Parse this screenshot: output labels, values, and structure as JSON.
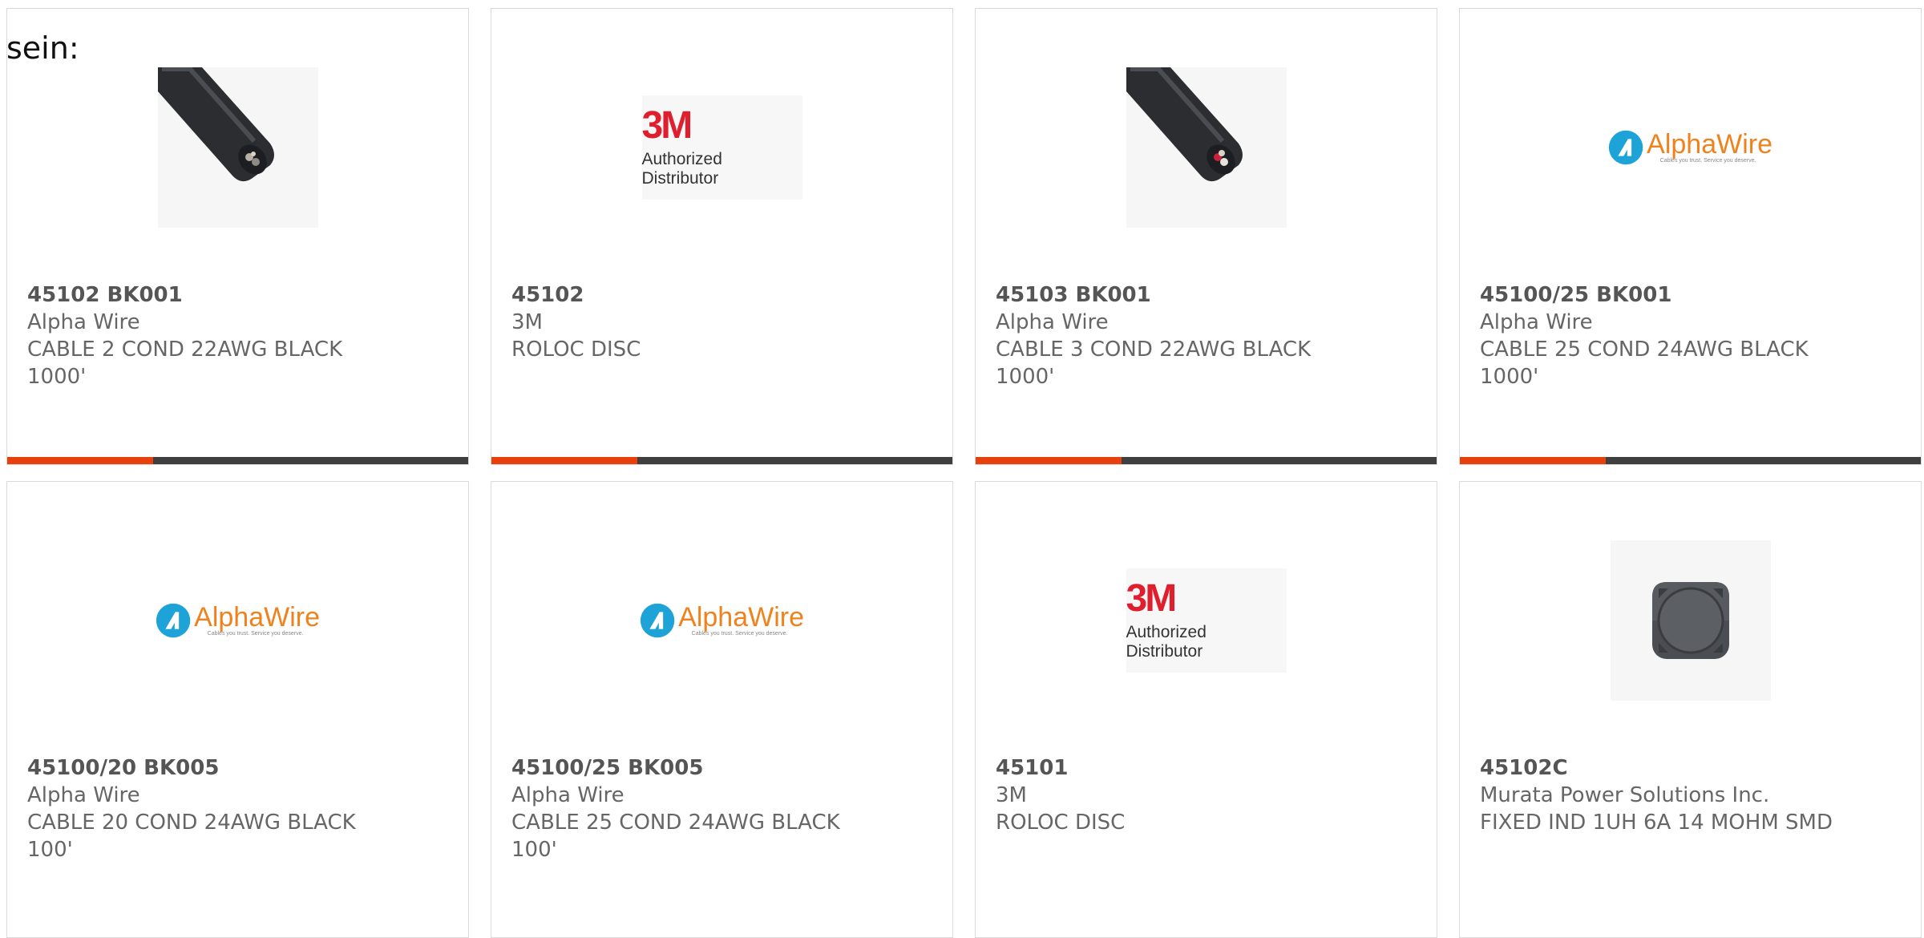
{
  "intro_text": "sein:",
  "colors": {
    "accent": "#e8400c",
    "bar": "#3f3f3f",
    "card_border": "#d9d9d9",
    "text": "#666666",
    "logo_3m_red": "#e01f2e",
    "alphawire_orange": "#f0821e",
    "alphawire_blue": "#1ea3d8"
  },
  "products": [
    {
      "part_number": "45102 BK001",
      "manufacturer": "Alpha Wire",
      "description": "CABLE 2 COND 22AWG BLACK 1000'",
      "image": "black-cable-image"
    },
    {
      "part_number": "45102",
      "manufacturer": "3M",
      "description": "ROLOC DISC",
      "image": "3m-authorized-distributor-logo",
      "logo_mark": "3M",
      "logo_sub": "Authorized Distributor"
    },
    {
      "part_number": "45103 BK001",
      "manufacturer": "Alpha Wire",
      "description": "CABLE 3 COND 22AWG BLACK 1000'",
      "image": "black-cable-image"
    },
    {
      "part_number": "45100/25 BK001",
      "manufacturer": "Alpha Wire",
      "description": "CABLE 25 COND 24AWG BLACK 1000'",
      "image": "alphawire-logo",
      "logo_name": "AlphaWire",
      "logo_tag": "Cables you trust. Service you deserve."
    },
    {
      "part_number": "45100/20 BK005",
      "manufacturer": "Alpha Wire",
      "description": "CABLE 20 COND 24AWG BLACK 100'",
      "image": "alphawire-logo",
      "logo_name": "AlphaWire",
      "logo_tag": "Cables you trust. Service you deserve."
    },
    {
      "part_number": "45100/25 BK005",
      "manufacturer": "Alpha Wire",
      "description": "CABLE 25 COND 24AWG BLACK 100'",
      "image": "alphawire-logo",
      "logo_name": "AlphaWire",
      "logo_tag": "Cables you trust. Service you deserve."
    },
    {
      "part_number": "45101",
      "manufacturer": "3M",
      "description": "ROLOC DISC",
      "image": "3m-authorized-distributor-logo",
      "logo_mark": "3M",
      "logo_sub": "Authorized Distributor"
    },
    {
      "part_number": "45102C",
      "manufacturer": "Murata Power Solutions Inc.",
      "description": "FIXED IND 1UH 6A 14 MOHM SMD",
      "image": "smd-inductor-image"
    }
  ]
}
